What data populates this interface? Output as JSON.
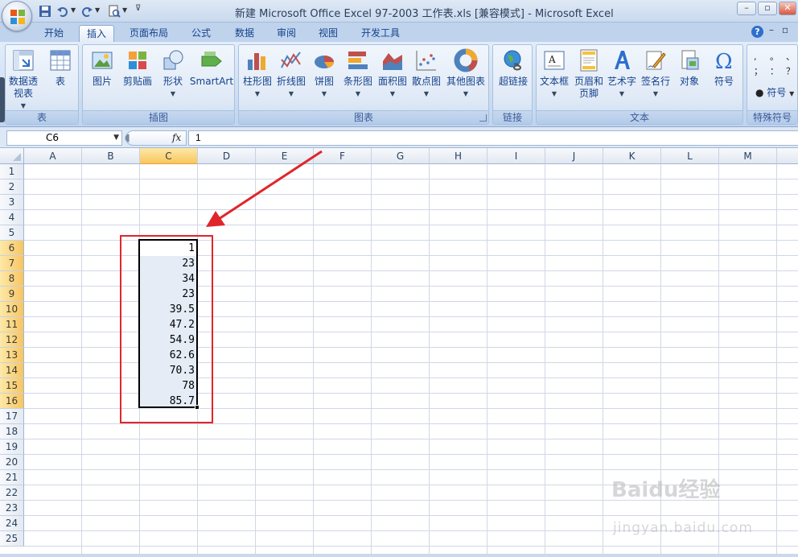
{
  "title": "新建 Microsoft Office Excel 97-2003 工作表.xls  [兼容模式] - Microsoft Excel",
  "window_controls": {
    "minimize": "–",
    "restore": "▫",
    "close": "✕"
  },
  "ribbon_controls": {
    "help": "?",
    "minimize": "–",
    "restore": "▫",
    "close": "✕"
  },
  "tabs": [
    "开始",
    "插入",
    "页面布局",
    "公式",
    "数据",
    "审阅",
    "视图",
    "开发工具"
  ],
  "active_tab": "插入",
  "groups": {
    "table": {
      "label": "表",
      "buttons": [
        "数据透视表",
        "表"
      ]
    },
    "illustrations": {
      "label": "插图",
      "buttons": [
        "图片",
        "剪贴画",
        "形状",
        "SmartArt"
      ]
    },
    "charts": {
      "label": "图表",
      "buttons": [
        "柱形图",
        "折线图",
        "饼图",
        "条形图",
        "面积图",
        "散点图",
        "其他图表"
      ]
    },
    "links": {
      "label": "链接",
      "buttons": [
        "超链接"
      ]
    },
    "text": {
      "label": "文本",
      "buttons": [
        "文本框",
        "页眉和页脚",
        "艺术字",
        "签名行",
        "对象",
        "符号"
      ]
    },
    "special_symbols": {
      "label": "特殊符号",
      "buttons": [
        "符号"
      ],
      "glyphs": [
        ", ",
        "。",
        "、",
        "；",
        "：",
        "？"
      ]
    }
  },
  "formula_bar": {
    "name_box": "C6",
    "fx_label": "fx",
    "formula": "1"
  },
  "columns": [
    "A",
    "B",
    "C",
    "D",
    "E",
    "F",
    "G",
    "H",
    "I",
    "J",
    "K",
    "L",
    "M"
  ],
  "selected_column": "C",
  "rows": [
    "1",
    "2",
    "3",
    "4",
    "5",
    "6",
    "7",
    "8",
    "9",
    "10",
    "11",
    "12",
    "13",
    "14",
    "15",
    "16",
    "17",
    "18",
    "19",
    "20",
    "21",
    "22",
    "23",
    "24",
    "25"
  ],
  "selected_rows": [
    "6",
    "7",
    "8",
    "9",
    "10",
    "11",
    "12",
    "13",
    "14",
    "15",
    "16"
  ],
  "cells_C": [
    "1",
    "23",
    "34",
    "23",
    "39.5",
    "47.2",
    "54.9",
    "62.6",
    "70.3",
    "78",
    "85.7"
  ],
  "active_cell": "C6",
  "colors": {
    "annotation": "#e0262a",
    "selection_header": "#f8c560",
    "selection_fill": "#e6ecf6"
  },
  "watermark": {
    "line1": "Baidu经验",
    "line2": "jingyan.baidu.com"
  }
}
